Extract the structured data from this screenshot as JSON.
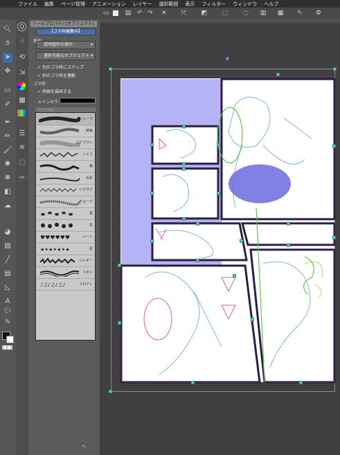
{
  "menubar": {
    "items": [
      "ファイル",
      "編集",
      "ページ管理",
      "アニメーション",
      "レイヤー",
      "選択範囲",
      "表示",
      "フィルター",
      "ウィンドウ",
      "ヘルプ"
    ]
  },
  "panel": {
    "title": "ツールプロパティ[オブジェクト]",
    "mode_button": "【コマ枠編集中】",
    "section_operation": "操作",
    "dropdown_target": "透明箇所の操作",
    "dropdown_object": "選択可能なオブジェクト",
    "check_snap": "別のコマ枠にスナップ",
    "check_link": "別のコマ枠を連動",
    "section_frame": "コマ枠",
    "check_draw_border": "枠線を描画する",
    "main_color_label": "メインカラー",
    "brush_shape_label": "ブラシ形状"
  },
  "brushes": [
    {
      "name": "シャープ"
    },
    {
      "name": "擦筆"
    },
    {
      "name": "エアブラシ"
    },
    {
      "name": "ノイズ"
    },
    {
      "name": "筆"
    },
    {
      "name": "水彩"
    },
    {
      "name": "ジグザグ"
    },
    {
      "name": "チョーク"
    },
    {
      "name": "葉"
    },
    {
      "name": "花"
    },
    {
      "name": "ハート"
    },
    {
      "name": "星"
    },
    {
      "name": "ジャギー"
    },
    {
      "name": "リボン"
    },
    {
      "name": "メロディ"
    }
  ],
  "colors": {
    "accent_handle": "#5fd3b4",
    "frame_border": "#2a1e45",
    "lavender_fill": "#b3b3f5",
    "sketch_blue": "#7fb3e6",
    "sketch_red": "#e6608a"
  }
}
